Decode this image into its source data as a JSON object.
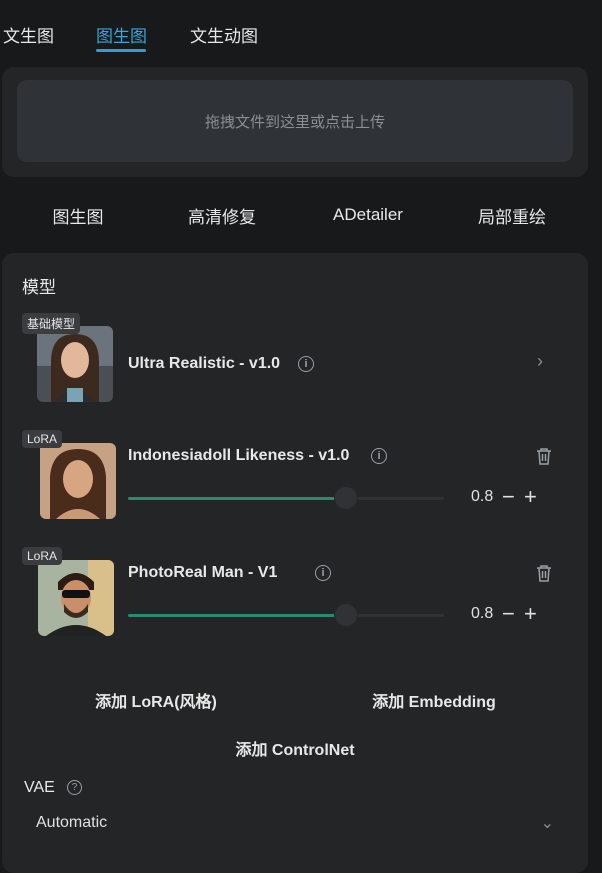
{
  "tabs": [
    "文生图",
    "图生图",
    "文生动图"
  ],
  "upload": {
    "text": "拖拽文件到这里或点击上传"
  },
  "subtabs": [
    "图生图",
    "高清修复",
    "ADetailer",
    "局部重绘"
  ],
  "model_section": {
    "title": "模型"
  },
  "models": [
    {
      "badge": "基础模型",
      "name": "Ultra Realistic - v1.0"
    },
    {
      "badge": "LoRA",
      "name": "Indonesiadoll Likeness - v1.0",
      "weight": "0.8",
      "slider_fraction": 0.68
    },
    {
      "badge": "LoRA",
      "name": "PhotoReal Man - V1",
      "weight": "0.8",
      "slider_fraction": 0.68
    }
  ],
  "buttons": {
    "add_lora": "添加 LoRA(风格)",
    "add_embedding": "添加 Embedding",
    "add_controlnet": "添加 ControlNet"
  },
  "vae": {
    "label": "VAE",
    "value": "Automatic"
  },
  "colors": {
    "accent": "#2f9ed6",
    "slider": "#2c8a6e",
    "panel": "#232527",
    "background": "#18191b"
  }
}
